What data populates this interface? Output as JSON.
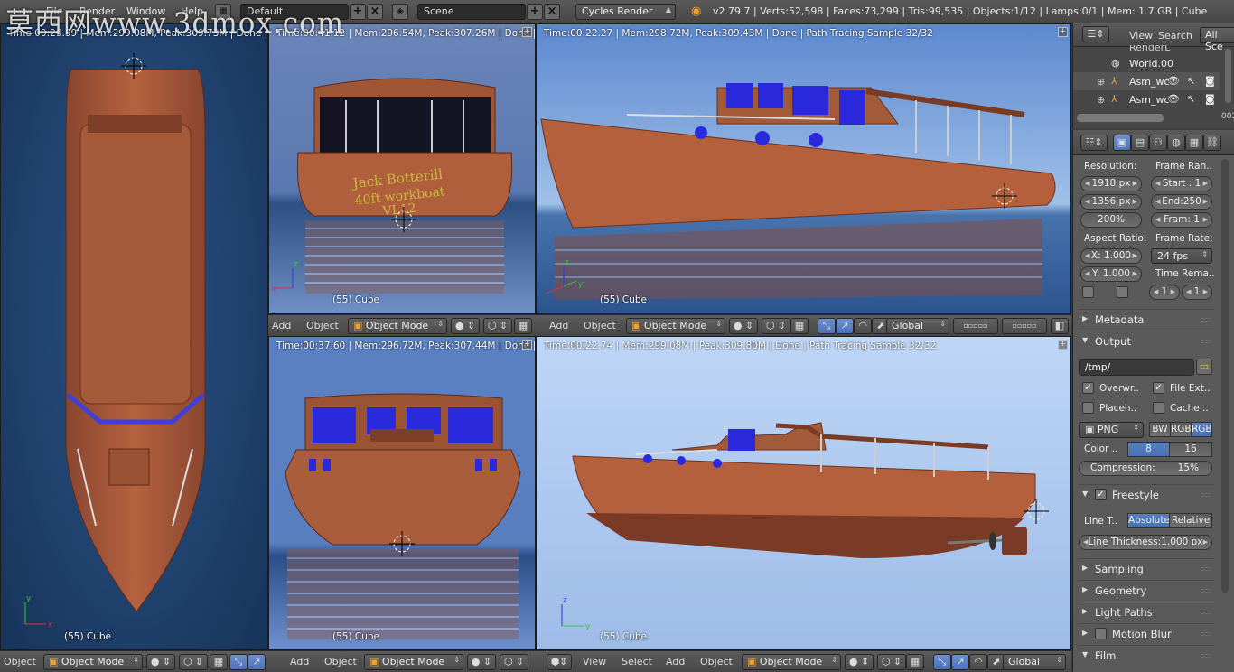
{
  "watermark": "莫西网www.3dmox.com",
  "topbar": {
    "menus": [
      "File",
      "Render",
      "Window",
      "Help"
    ],
    "layout": "Default",
    "scene": "Scene",
    "engine": "Cycles Render",
    "stats": "v2.79.7 | Verts:52,598 | Faces:73,299 | Tris:99,535 | Objects:1/12 | Lamps:0/1 | Mem: 1.7 GB | Cube"
  },
  "viewports": {
    "left": {
      "stat": "Time:00:29.59 | Mem:299.08M, Peak:309.73M | Done | Pa",
      "object": "(55) Cube"
    },
    "top_mid": {
      "stat": "Time:00:41.12 | Mem:296.54M, Peak:307.26M | Done | Pat",
      "object": "(55) Cube",
      "boat_text1": "Jack Botterill",
      "boat_text2": "40ft workboat",
      "boat_text3": "VL12"
    },
    "top_right": {
      "stat": "Time:00:22.27 | Mem:298.72M, Peak:309.43M | Done | Path Tracing Sample 32/32",
      "object": "(55) Cube"
    },
    "bot_mid": {
      "stat": "Time:00:37.60 | Mem:296.72M, Peak:307.44M | Done | Pat",
      "object": "(55) Cube"
    },
    "bot_right": {
      "stat": "Time:00:22.74 | Mem:299.08M | Peak:309.80M | Done | Path Tracing Sample 32/32",
      "object": "(55) Cube"
    }
  },
  "headers": {
    "add": "Add",
    "object": "Object",
    "view": "View",
    "select": "Select",
    "mode": "Object Mode",
    "orientation": "Global"
  },
  "outliner": {
    "view": "View",
    "search": "Search",
    "all_scenes": "All Sce",
    "rows": [
      "RenderL",
      "World.00",
      "Asm_wc",
      "Asm_wc"
    ],
    "counter": "002"
  },
  "props": {
    "resolution_label": "Resolution:",
    "res_x": "1918 px",
    "res_y": "1356 px",
    "res_pct": "200%",
    "frame_range_label": "Frame Ran..",
    "start": "Start : 1",
    "end": "End:250",
    "frame_step": "Fram: 1",
    "aspect_label": "Aspect Ratio:",
    "aspect_x": "X: 1.000",
    "aspect_y": "Y: 1.000",
    "frame_rate_label": "Frame Rate:",
    "fps": "24 fps",
    "time_remap_label": "Time Rema..",
    "remap_old": "1",
    "remap_new": "1",
    "metadata": "Metadata",
    "output": "Output",
    "path": "/tmp/",
    "overwrite": "Overwr..",
    "file_ext": "File Ext..",
    "placeholders": "Placeh..",
    "cache": "Cache ..",
    "format": "PNG",
    "bw": "BW",
    "rgb": "RGB",
    "rgba": "RGB",
    "color_depth": "Color ..",
    "depth8": "8",
    "depth16": "16",
    "compression": "Compression:",
    "compression_val": "15%",
    "freestyle": "Freestyle",
    "line_t": "Line T..",
    "absolute": "Absolute",
    "relative": "Relative",
    "line_thickness": "Line Thickness:1.000 px",
    "sampling": "Sampling",
    "geometry": "Geometry",
    "light_paths": "Light Paths",
    "motion_blur": "Motion Blur",
    "film": "Film"
  },
  "colors": {
    "accent": "#5680c2",
    "hull": "#b0603e",
    "water_dark": "#1f3d62",
    "sky_light": "#a9c8ef"
  }
}
